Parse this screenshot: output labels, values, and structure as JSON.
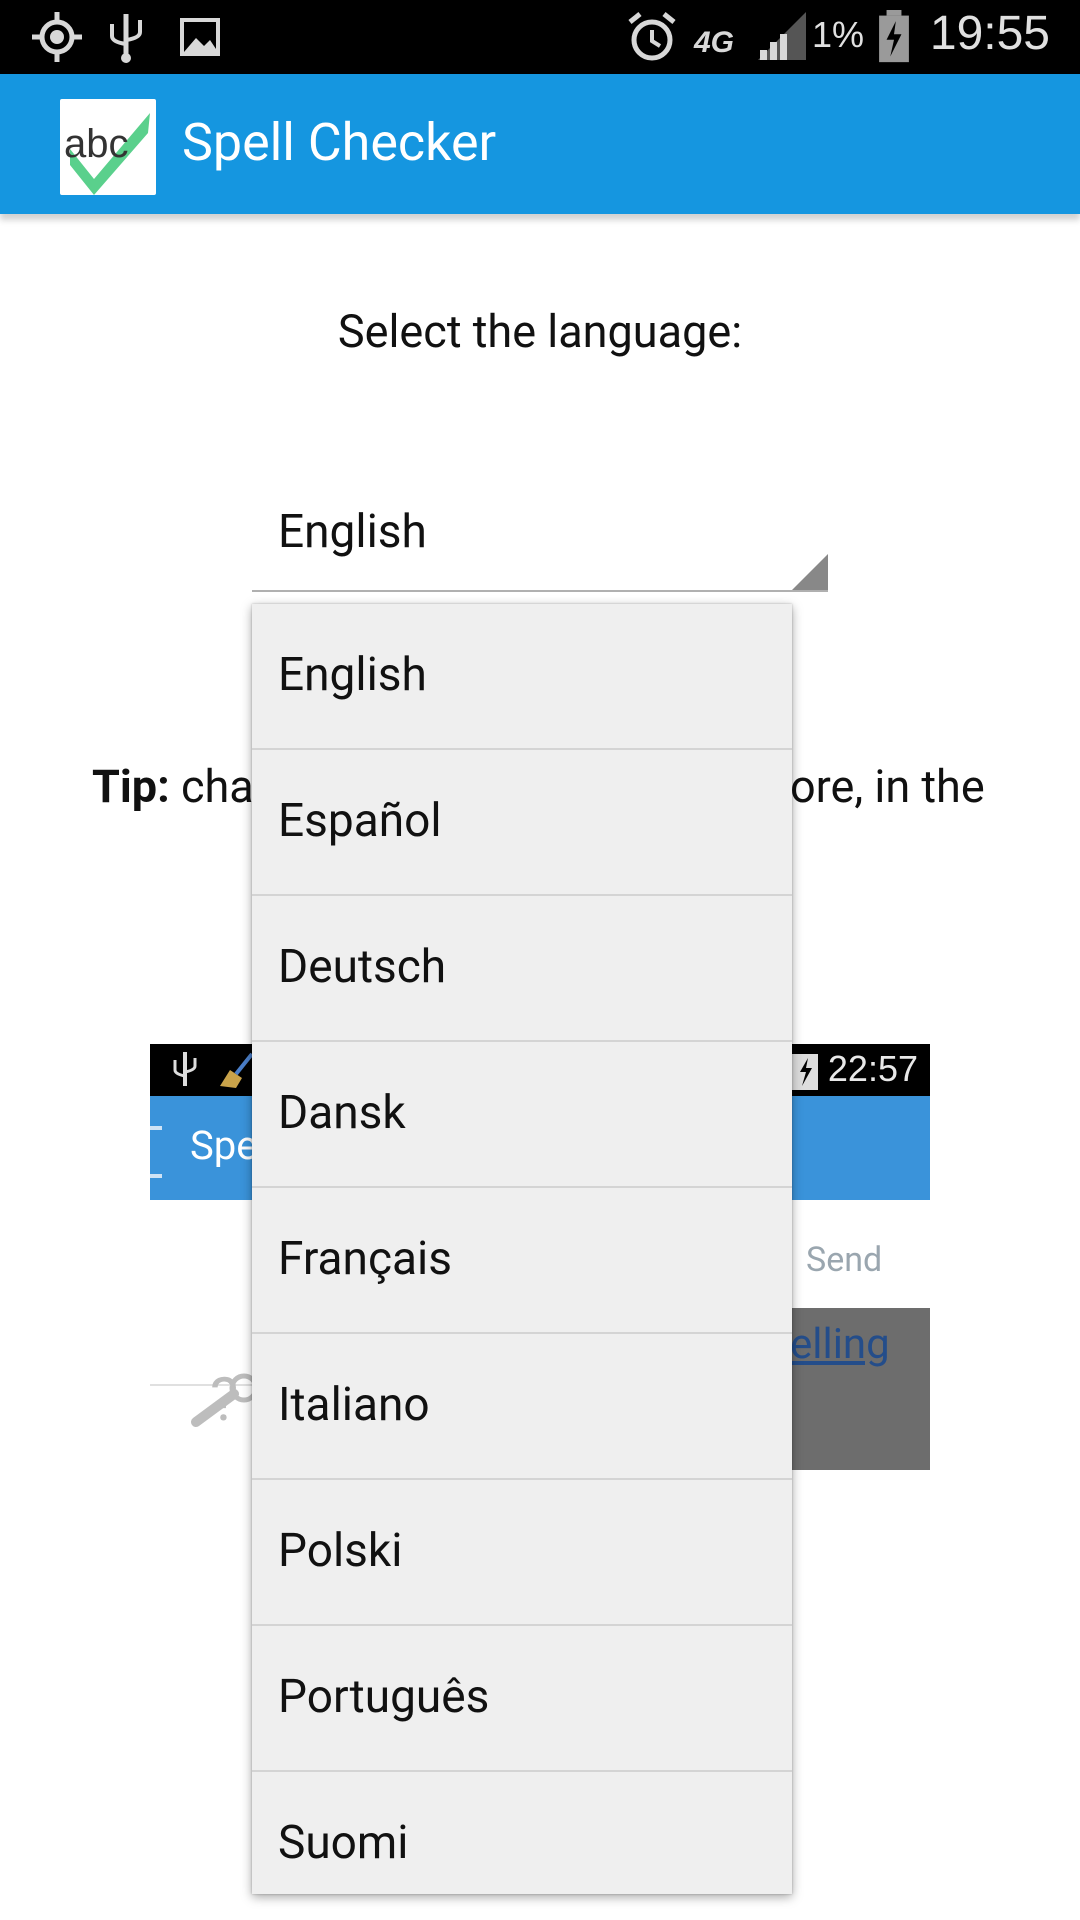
{
  "status_bar": {
    "time": "19:55",
    "battery_percent": "1%",
    "network": "4G",
    "icons": [
      "location-icon",
      "usb-icon",
      "image-icon",
      "alarm-icon",
      "network-4g-icon",
      "signal-icon",
      "battery-charging-icon"
    ]
  },
  "app_bar": {
    "title": "Spell Checker",
    "logo_text": "abc"
  },
  "main": {
    "prompt": "Select the language:",
    "spinner_value": "English",
    "tip_bold": "Tip:",
    "tip_visible_start": " cha",
    "tip_visible_end": "ore, in the"
  },
  "embedded_screenshot": {
    "time": "22:57",
    "app_bar_text": "Spe",
    "send_label": "Send",
    "link_text": "elling"
  },
  "dropdown": {
    "options": [
      {
        "label": "English"
      },
      {
        "label": "Español"
      },
      {
        "label": "Deutsch"
      },
      {
        "label": "Dansk"
      },
      {
        "label": "Français"
      },
      {
        "label": "Italiano"
      },
      {
        "label": "Polski"
      },
      {
        "label": "Português"
      },
      {
        "label": "Suomi"
      }
    ]
  },
  "colors": {
    "app_bar": "#1596e0",
    "status_bar": "#000000",
    "dropdown_bg": "#efefef",
    "logo_check": "#5ad08c"
  }
}
